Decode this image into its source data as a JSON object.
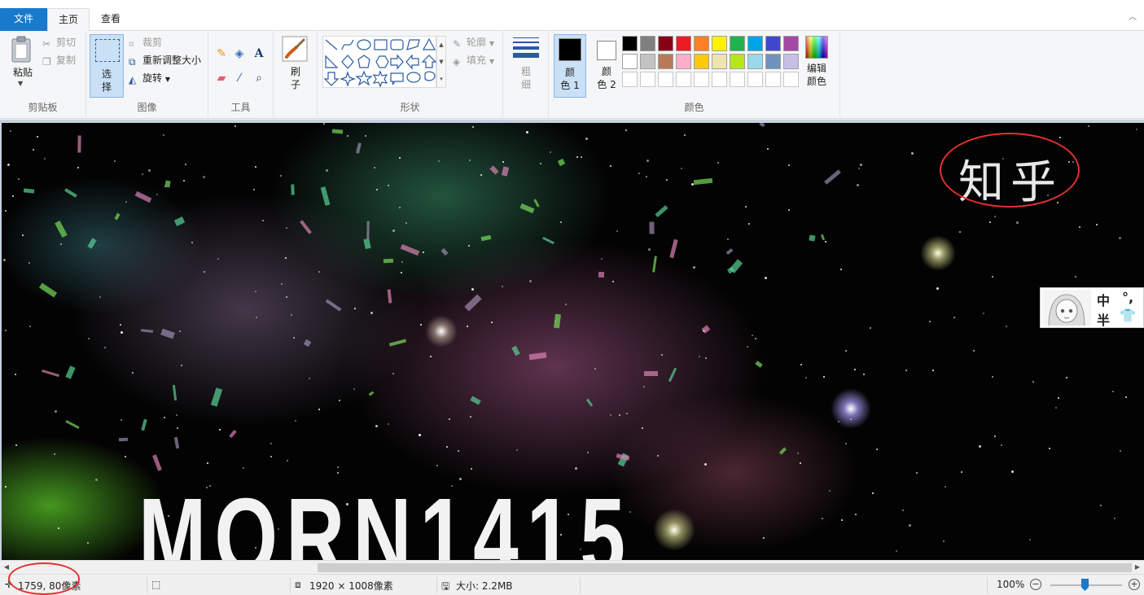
{
  "titlebar": {
    "quick_access": "",
    "title": ""
  },
  "tabs": {
    "file": "文件",
    "home": "主页",
    "view": "查看"
  },
  "ribbon": {
    "clipboard": {
      "paste": "粘贴",
      "cut": "剪切",
      "copy": "复制",
      "group_label": "剪贴板"
    },
    "image": {
      "select": "选\n择",
      "crop": "裁剪",
      "resize": "重新调整大小",
      "rotate": "旋转",
      "group_label": "图像"
    },
    "tools": {
      "group_label": "工具"
    },
    "brush": {
      "label": "刷\n子"
    },
    "shapes": {
      "outline": "轮廓",
      "fill": "填充",
      "group_label": "形状"
    },
    "size": {
      "label": "粗\n细"
    },
    "colors": {
      "color1": "颜\n色 1",
      "color2": "颜\n色 2",
      "edit": "编辑\n颜色",
      "group_label": "颜色",
      "color1_value": "#000000",
      "color2_value": "#ffffff",
      "palette_row1": [
        "#000000",
        "#7f7f7f",
        "#880015",
        "#ed1c24",
        "#ff7f27",
        "#fff200",
        "#22b14c",
        "#00a2e8",
        "#3f48cc",
        "#a349a4"
      ],
      "palette_row2": [
        "#ffffff",
        "#c3c3c3",
        "#b97a57",
        "#ffaec9",
        "#ffc90e",
        "#efe4b0",
        "#b5e61d",
        "#99d9ea",
        "#7092be",
        "#c8bfe7"
      ],
      "palette_row3": [
        "#ffffff",
        "#ffffff",
        "#ffffff",
        "#ffffff",
        "#ffffff",
        "#ffffff",
        "#ffffff",
        "#ffffff",
        "#ffffff",
        "#ffffff"
      ]
    }
  },
  "canvas": {
    "logo_text": "知乎",
    "banner_text": "MORN1415",
    "ime": {
      "key1": "中",
      "key2": "°,",
      "key3": "半",
      "key4": "👕"
    }
  },
  "status": {
    "position": "1759, 80像素",
    "image_size": "1920 × 1008像素",
    "file_size": "大小: 2.2MB",
    "zoom": "100%"
  }
}
